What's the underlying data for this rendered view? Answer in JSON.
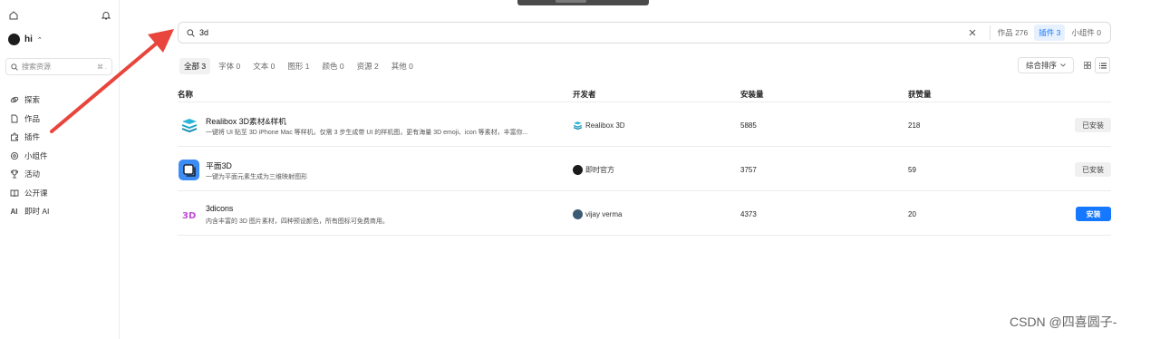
{
  "sidebar": {
    "user": "hi",
    "search": {
      "placeholder": "搜索资源",
      "shortcut": "⌘ ."
    },
    "items": [
      {
        "label": "探索",
        "icon": "explore-icon"
      },
      {
        "label": "作品",
        "icon": "file-icon"
      },
      {
        "label": "插件",
        "icon": "puzzle-icon"
      },
      {
        "label": "小组件",
        "icon": "widget-icon"
      },
      {
        "label": "活动",
        "icon": "trophy-icon"
      },
      {
        "label": "公开课",
        "icon": "book-icon"
      },
      {
        "label": "即时 AI",
        "icon": "ai-icon"
      }
    ]
  },
  "search": {
    "value": "3d"
  },
  "scope_tabs": [
    {
      "label": "作品",
      "count": "276",
      "active": false
    },
    {
      "label": "插件",
      "count": "3",
      "active": true
    },
    {
      "label": "小组件",
      "count": "0",
      "active": false
    }
  ],
  "filters": [
    {
      "label": "全部",
      "count": "3",
      "active": true
    },
    {
      "label": "字体",
      "count": "0"
    },
    {
      "label": "文本",
      "count": "0"
    },
    {
      "label": "图形",
      "count": "1"
    },
    {
      "label": "颜色",
      "count": "0"
    },
    {
      "label": "资源",
      "count": "2"
    },
    {
      "label": "其他",
      "count": "0"
    }
  ],
  "sort": {
    "label": "综合排序"
  },
  "table": {
    "headers": {
      "name": "名称",
      "developer": "开发者",
      "installs": "安装量",
      "likes": "获赞量"
    },
    "rows": [
      {
        "name": "Realibox 3D素材&样机",
        "desc": "一键将 UI 贴至 3D iPhone Mac 等样机，仅需 3 步生成带 UI 的样机图，更有海量 3D emoji、icon 等素材，丰富你...",
        "developer": "Realibox 3D",
        "installs": "5885",
        "likes": "218",
        "action": "已安装"
      },
      {
        "name": "平面3D",
        "desc": "一键为平面元素生成为三维映射图形",
        "developer": "即时官方",
        "installs": "3757",
        "likes": "59",
        "action": "已安装"
      },
      {
        "name": "3dicons",
        "desc": "内含丰富的 3D 图片素材，四种预设颜色，所有图标可免费商用。",
        "developer": "vijay verma",
        "installs": "4373",
        "likes": "20",
        "action": "安装"
      }
    ]
  },
  "watermark": "CSDN @四喜圆子-",
  "colors": {
    "accent": "#1677ff",
    "arrow": "#e8453c"
  }
}
